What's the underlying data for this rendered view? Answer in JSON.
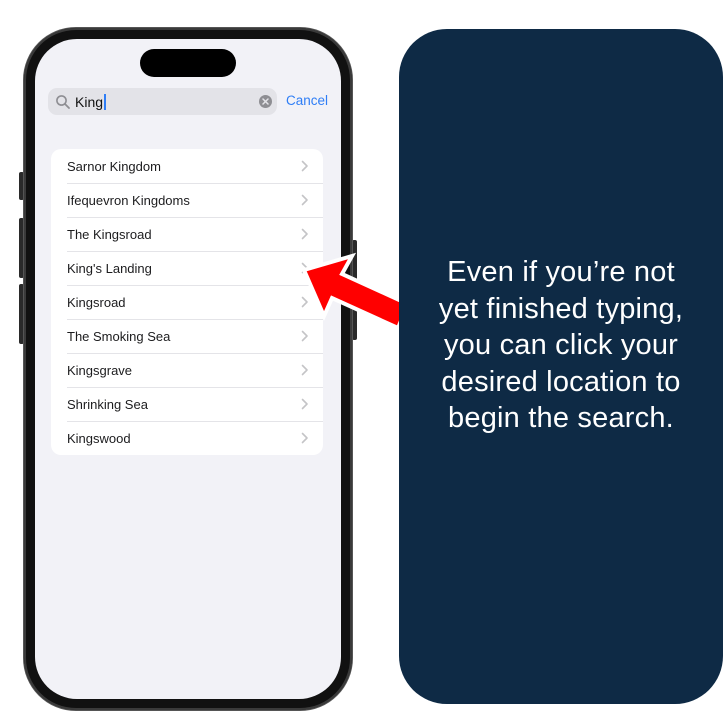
{
  "search": {
    "query": "King",
    "cancel_label": "Cancel"
  },
  "results": [
    {
      "label": "Sarnor Kingdom"
    },
    {
      "label": "Ifequevron Kingdoms"
    },
    {
      "label": "The Kingsroad"
    },
    {
      "label": "King's Landing"
    },
    {
      "label": "Kingsroad"
    },
    {
      "label": "The Smoking Sea"
    },
    {
      "label": "Kingsgrave"
    },
    {
      "label": "Shrinking Sea"
    },
    {
      "label": "Kingswood"
    }
  ],
  "callout": {
    "lines": [
      "Even if you’re not",
      "yet finished typing,",
      "you can click your",
      "desired location to",
      "begin the search."
    ]
  },
  "colors": {
    "accent": "#2f7ef6",
    "card_background": "#0e2a45",
    "arrow": "#ff0000"
  },
  "icons": [
    "search-icon",
    "clear-icon",
    "chevron-right-icon",
    "arrow-pointer-icon"
  ]
}
